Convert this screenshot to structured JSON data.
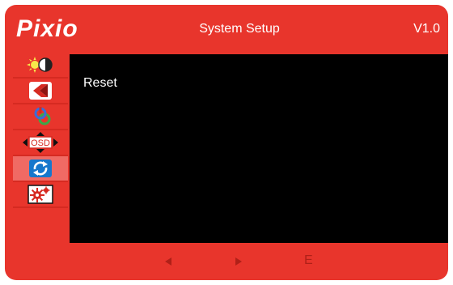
{
  "header": {
    "logo": "Pixio",
    "title": "System Setup",
    "version": "V1.0"
  },
  "sidebar": {
    "items": [
      {
        "icon": "brightness-contrast-icon"
      },
      {
        "icon": "picture-icon"
      },
      {
        "icon": "color-icon"
      },
      {
        "icon": "osd-position-icon",
        "label": "OSD"
      },
      {
        "icon": "reset-icon",
        "active": true
      },
      {
        "icon": "settings-icon"
      }
    ]
  },
  "content": {
    "item_label": "Reset"
  },
  "footer": {
    "left_icon": "left-arrow-icon",
    "right_icon": "right-arrow-icon",
    "exit_label": "E"
  },
  "colors": {
    "frame": "#e8352c",
    "content_bg": "#000000",
    "active_item": "#f06a64",
    "text": "#ffffff",
    "footer_glyph": "#b02018"
  }
}
